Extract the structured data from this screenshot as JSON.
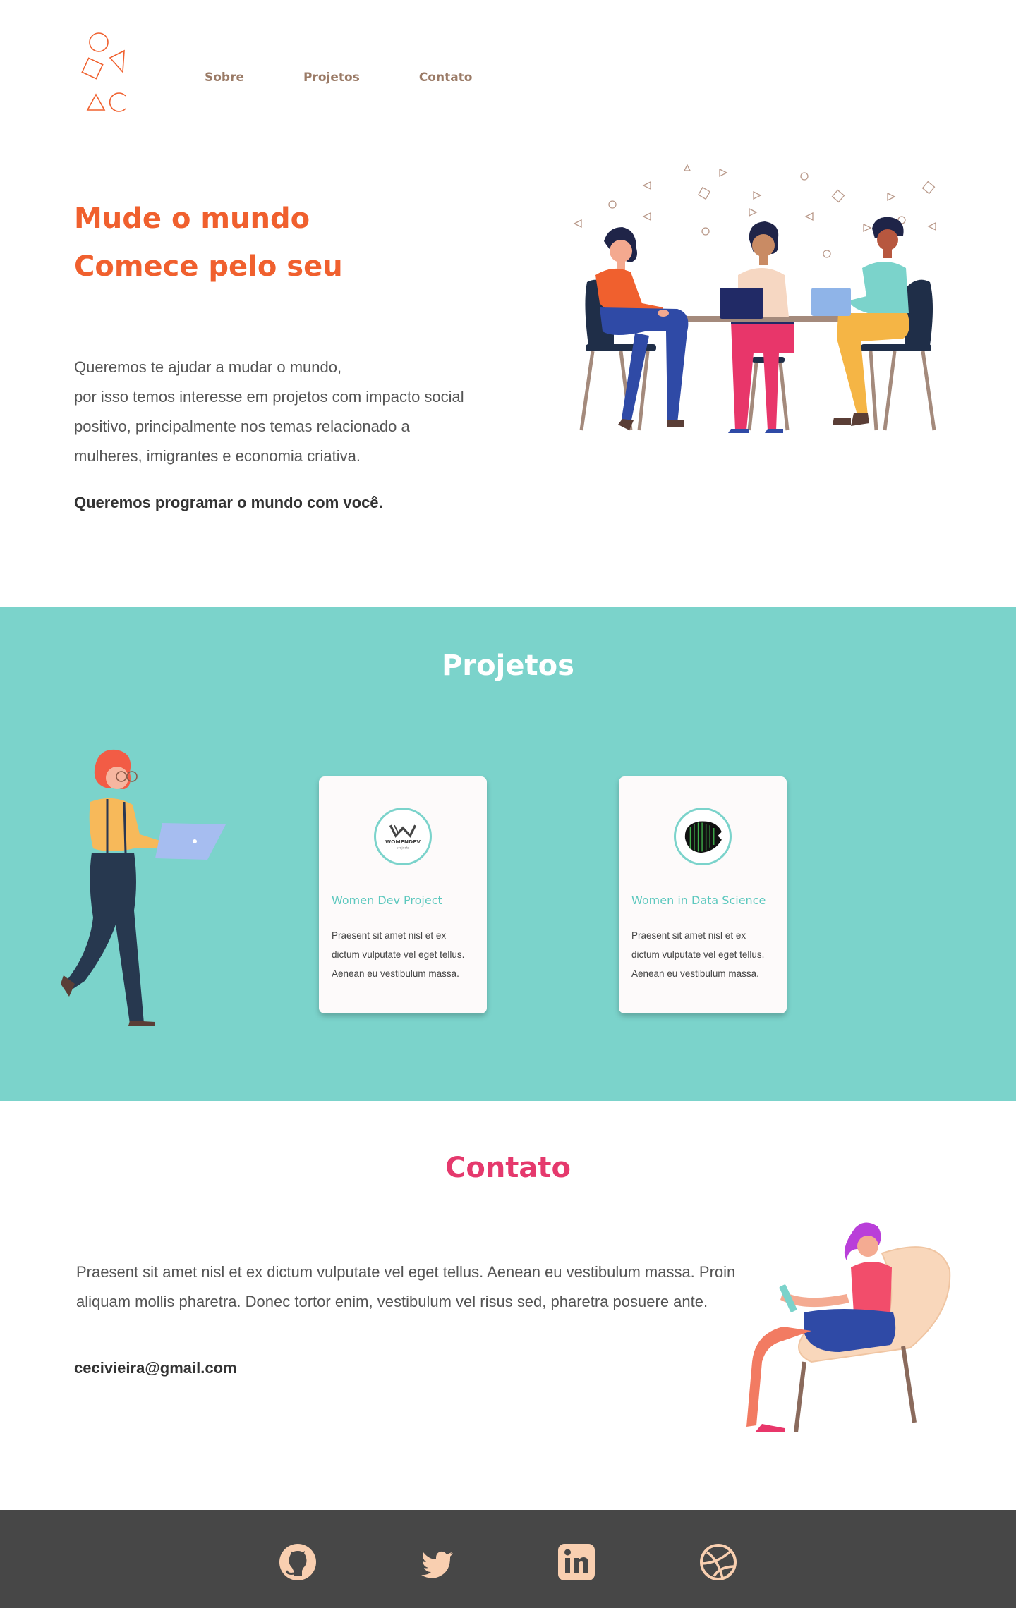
{
  "nav": {
    "items": [
      {
        "label": "Sobre"
      },
      {
        "label": "Projetos"
      },
      {
        "label": "Contato"
      }
    ]
  },
  "hero": {
    "title_line1": "Mude o mundo",
    "title_line2": "Comece pelo seu",
    "desc_lines": [
      "Queremos te ajudar a mudar o mundo,",
      "por isso temos interesse em projetos com impacto social",
      "positivo, principalmente nos temas relacionado a",
      "mulheres, imigrantes e economia criativa."
    ],
    "strong": "Queremos programar o mundo com você."
  },
  "projects": {
    "title": "Projetos",
    "cards": [
      {
        "badge_text": "WOMENDEV",
        "badge_sub": "projects",
        "title": "Women Dev Project",
        "text": "Praesent sit amet nisl et ex dictum vulputate vel eget tellus. Aenean eu vestibulum massa."
      },
      {
        "title": "Women in Data Science",
        "text": "Praesent sit amet nisl et ex dictum vulputate vel eget tellus. Aenean eu vestibulum massa."
      }
    ]
  },
  "contact": {
    "title": "Contato",
    "text": "Praesent sit amet nisl et ex dictum vulputate vel eget tellus. Aenean eu vestibulum massa. Proin aliquam mollis pharetra. Donec tortor enim, vestibulum vel risus sed, pharetra posuere ante.",
    "email": "cecivieira@gmail.com"
  },
  "footer": {
    "icons": [
      "github-icon",
      "twitter-icon",
      "linkedin-icon",
      "dribbble-icon"
    ]
  },
  "colors": {
    "accent_orange": "#f0602e",
    "teal": "#7bd3cb",
    "pink": "#e5396d",
    "nav_brown": "#9b7b67",
    "footer_bg": "#474747",
    "icon_peach": "#f9cfb0"
  }
}
